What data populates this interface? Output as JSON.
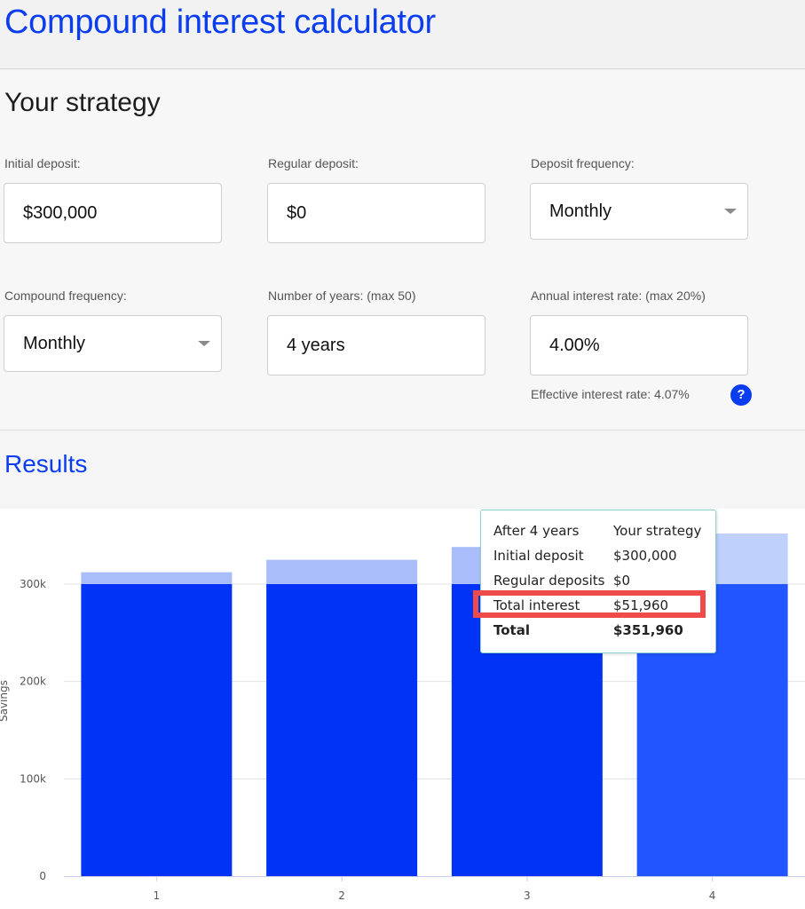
{
  "header": {
    "title": "Compound interest calculator"
  },
  "strategy": {
    "title": "Your strategy",
    "initial_deposit": {
      "label": "Initial deposit:",
      "value": "$300,000"
    },
    "regular_deposit": {
      "label": "Regular deposit:",
      "value": "$0"
    },
    "deposit_frequency": {
      "label": "Deposit frequency:",
      "value": "Monthly"
    },
    "compound_frequency": {
      "label": "Compound frequency:",
      "value": "Monthly"
    },
    "years": {
      "label": "Number of years: (max 50)",
      "value": "4 years"
    },
    "rate": {
      "label": "Annual interest rate: (max 20%)",
      "value": "4.00%"
    },
    "effective_rate": "Effective interest rate: 4.07%",
    "help_icon": "?"
  },
  "results": {
    "title": "Results"
  },
  "chart_data": {
    "type": "bar",
    "stacked": true,
    "categories": [
      "1",
      "2",
      "3",
      "4"
    ],
    "series": [
      {
        "color": "#0033f5",
        "hover_color": "#2255ff",
        "values": [
          300000,
          300000,
          300000,
          300000
        ]
      },
      {
        "color": "#a9bdfb",
        "hover_color": "#bfd0fc",
        "values": [
          12210,
          24920,
          38150,
          51960
        ]
      }
    ],
    "ylabel": "Savings",
    "ylim": [
      0,
      360000
    ],
    "yticks": [
      "0",
      "100k",
      "200k",
      "300k"
    ],
    "ytick_values": [
      0,
      100000,
      200000,
      300000
    ],
    "grid": true,
    "highlighted_index": 3
  },
  "tooltip": {
    "header": {
      "label": "After 4 years",
      "value": "Your strategy"
    },
    "rows": [
      {
        "label": "Initial deposit",
        "value": "$300,000"
      },
      {
        "label": "Regular deposits",
        "value": "$0"
      },
      {
        "label": "Total interest",
        "value": "$51,960"
      },
      {
        "label": "Total",
        "value": "$351,960"
      }
    ]
  }
}
